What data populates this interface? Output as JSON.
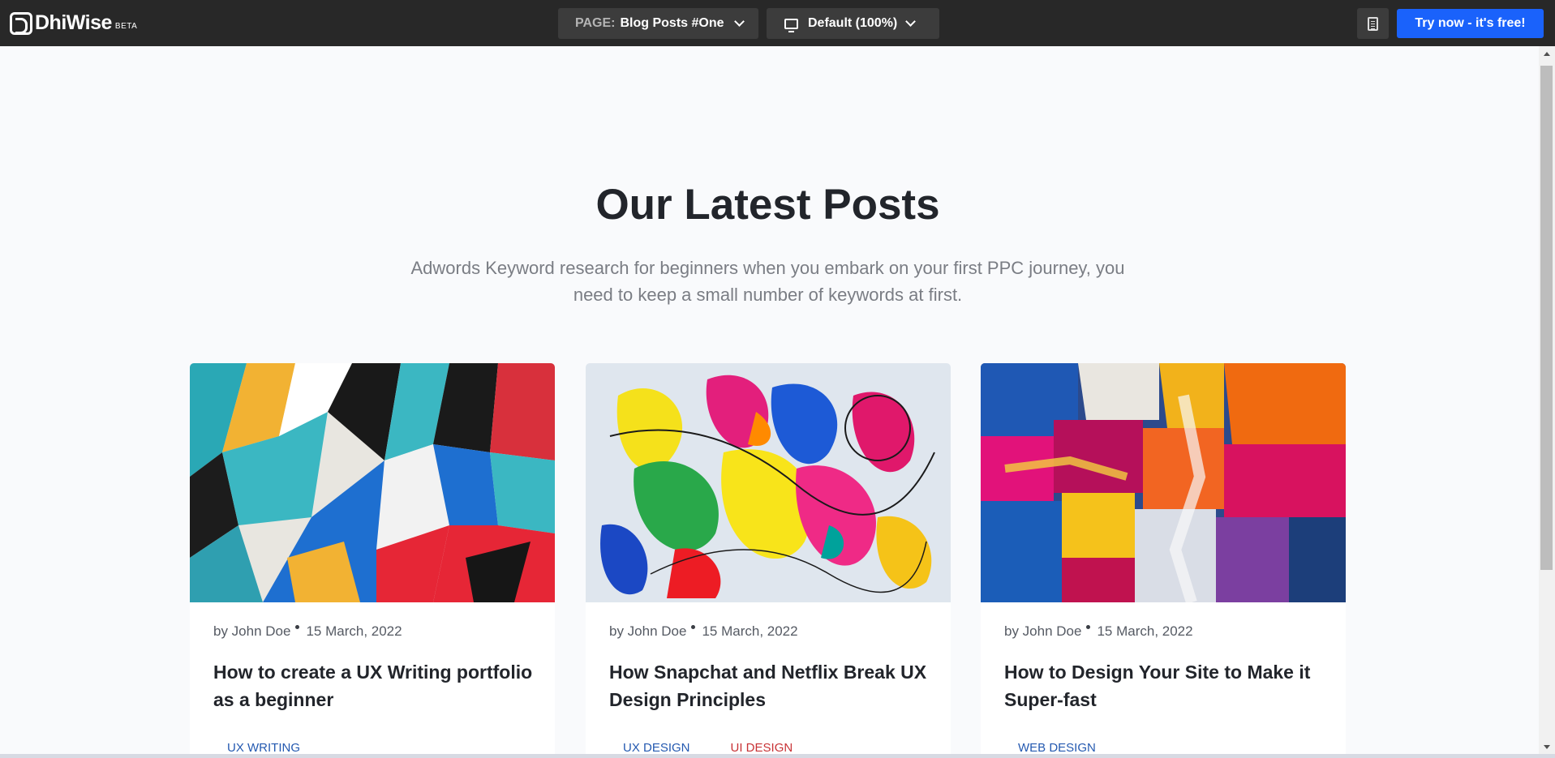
{
  "app": {
    "logo_text": "DhiWise",
    "logo_badge": "BETA"
  },
  "toolbar": {
    "page_key": "PAGE:",
    "page_value": "Blog Posts #One",
    "device_label": "Default (100%)",
    "cta_label": "Try now - it's free!"
  },
  "section": {
    "title": "Our Latest Posts",
    "subtitle": "Adwords Keyword research for beginners when you embark on your first PPC journey, you need to keep a small number of keywords at first."
  },
  "posts": [
    {
      "author": "by John Doe",
      "date": "15 March, 2022",
      "title": "How to create a UX Writing portfolio as a beginner",
      "tags": [
        {
          "label": "UX WRITING",
          "color": "#2459b0"
        }
      ]
    },
    {
      "author": "by John Doe",
      "date": "15 March, 2022",
      "title": "How Snapchat and Netflix Break UX Design Principles",
      "tags": [
        {
          "label": "UX DESIGN",
          "color": "#2459b0"
        },
        {
          "label": "UI DESIGN",
          "color": "#c83235"
        }
      ]
    },
    {
      "author": "by John Doe",
      "date": "15 March, 2022",
      "title": "How to Design Your Site to Make it Super-fast",
      "tags": [
        {
          "label": "WEB DESIGN",
          "color": "#2459b0"
        }
      ]
    }
  ],
  "colors": {
    "toolbar_bg": "#282828",
    "accent": "#1a62fb",
    "tag_blue": "#2459b0",
    "tag_red": "#c83235"
  },
  "icons": [
    "logo-icon",
    "chevron-down-icon",
    "monitor-icon",
    "document-icon"
  ]
}
